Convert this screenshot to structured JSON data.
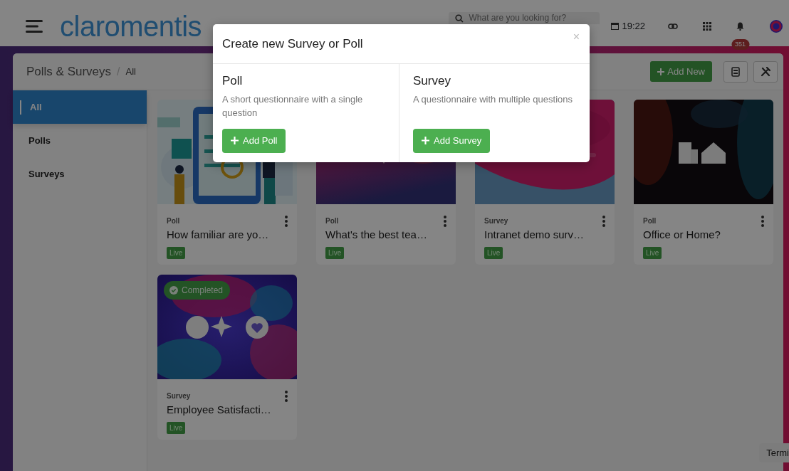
{
  "header": {
    "logo": "claromentis",
    "search": {
      "placeholder": "What are you looking for?"
    },
    "time": "19:22",
    "notification_count": "351"
  },
  "breadcrumb": [
    "Polls & Surveys",
    "All"
  ],
  "breadcrumb_separator": "/",
  "toolbar": {
    "add_button": "Add New"
  },
  "sidebar": {
    "items": [
      {
        "label": "All",
        "selected": true
      },
      {
        "label": "Polls",
        "selected": false
      },
      {
        "label": "Surveys",
        "selected": false
      }
    ]
  },
  "cards": [
    {
      "type": "Poll",
      "title": "How familiar are yo…",
      "status": "Live",
      "completed": false
    },
    {
      "type": "Poll",
      "title": "What's the best tea…",
      "status": "Live",
      "completed": false
    },
    {
      "type": "Survey",
      "title": "Intranet demo surv…",
      "status": "Live",
      "completed": false
    },
    {
      "type": "Poll",
      "title": "Office or Home?",
      "status": "Live",
      "completed": false
    },
    {
      "type": "Survey",
      "title": "Employee Satisfacti…",
      "status": "Live",
      "completed": true,
      "completed_label": "Completed"
    }
  ],
  "modal": {
    "title": "Create new Survey or Poll",
    "close": "×",
    "options": [
      {
        "title": "Poll",
        "description": "A short questionnaire with a single question",
        "button": "Add Poll"
      },
      {
        "title": "Survey",
        "description": "A questionnaire with multiple questions",
        "button": "Add Survey"
      }
    ]
  },
  "tooltip": "Termi"
}
